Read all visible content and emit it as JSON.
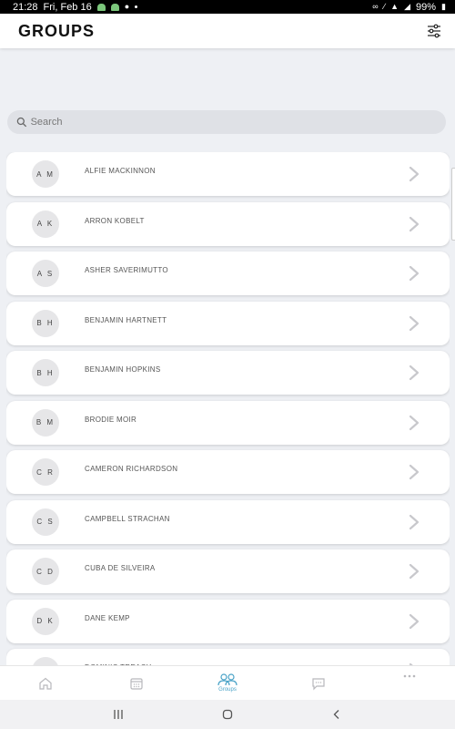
{
  "status_bar": {
    "time": "21:28",
    "date": "Fri, Feb 16",
    "battery": "99%"
  },
  "header": {
    "title": "GROUPS",
    "filter_icon": "sliders-icon"
  },
  "search": {
    "placeholder": "Search"
  },
  "groups": [
    {
      "initials": "A M",
      "name": "ALFIE MACKINNON"
    },
    {
      "initials": "A K",
      "name": "ARRON KOBELT"
    },
    {
      "initials": "A S",
      "name": "ASHER SAVERIMUTTO"
    },
    {
      "initials": "B H",
      "name": "BENJAMIN HARTNETT"
    },
    {
      "initials": "B H",
      "name": "BENJAMIN HOPKINS"
    },
    {
      "initials": "B M",
      "name": "BRODIE MOIR"
    },
    {
      "initials": "C R",
      "name": "CAMERON RICHARDSON"
    },
    {
      "initials": "C S",
      "name": "CAMPBELL STRACHAN"
    },
    {
      "initials": "C D",
      "name": "CUBA DE SILVEIRA"
    },
    {
      "initials": "D K",
      "name": "DANE KEMP"
    },
    {
      "initials": "D T",
      "name": "DOMINIC TREACY"
    }
  ],
  "tabs": [
    {
      "icon": "home-icon",
      "label": ""
    },
    {
      "icon": "calendar-icon",
      "label": ""
    },
    {
      "icon": "groups-icon",
      "label": "Groups",
      "active": true
    },
    {
      "icon": "chat-icon",
      "label": ""
    },
    {
      "icon": "more-icon",
      "label": ""
    }
  ],
  "colors": {
    "accent": "#4aa3c7",
    "background": "#eef0f4",
    "inactive_icon": "#b8b8bc"
  }
}
